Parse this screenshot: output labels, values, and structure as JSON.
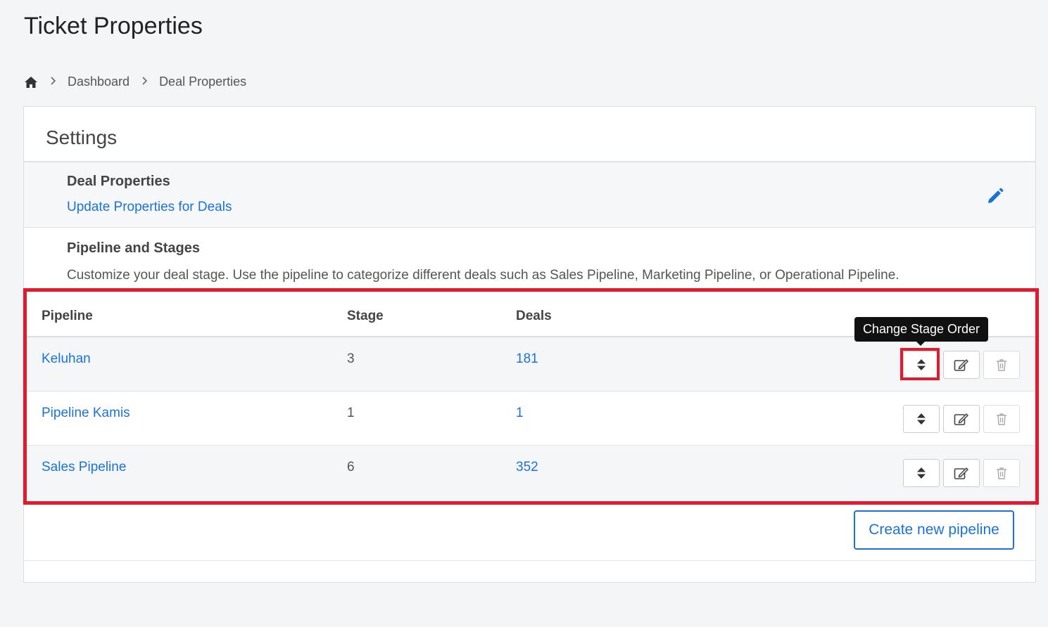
{
  "page": {
    "title": "Ticket Properties"
  },
  "breadcrumb": {
    "items": [
      "Dashboard",
      "Deal Properties"
    ]
  },
  "card": {
    "header": "Settings",
    "deal_properties": {
      "title": "Deal Properties",
      "link": "Update Properties for Deals"
    },
    "pipeline_section": {
      "title": "Pipeline and Stages",
      "description": "Customize your deal stage. Use the pipeline to categorize different deals such as Sales Pipeline, Marketing Pipeline, or Operational Pipeline."
    }
  },
  "table": {
    "headers": {
      "pipeline": "Pipeline",
      "stage": "Stage",
      "deals": "Deals"
    },
    "rows": [
      {
        "pipeline": "Keluhan",
        "stage": "3",
        "deals": "181"
      },
      {
        "pipeline": "Pipeline Kamis",
        "stage": "1",
        "deals": "1"
      },
      {
        "pipeline": "Sales Pipeline",
        "stage": "6",
        "deals": "352"
      }
    ]
  },
  "tooltip": "Change Stage Order",
  "create_button": "Create new pipeline",
  "colors": {
    "link": "#1a73d9",
    "highlight": "#e4192d"
  },
  "icons": [
    "home-icon",
    "chevron-right-icon",
    "pencil-icon",
    "sort-icon",
    "edit-icon",
    "trash-icon"
  ]
}
